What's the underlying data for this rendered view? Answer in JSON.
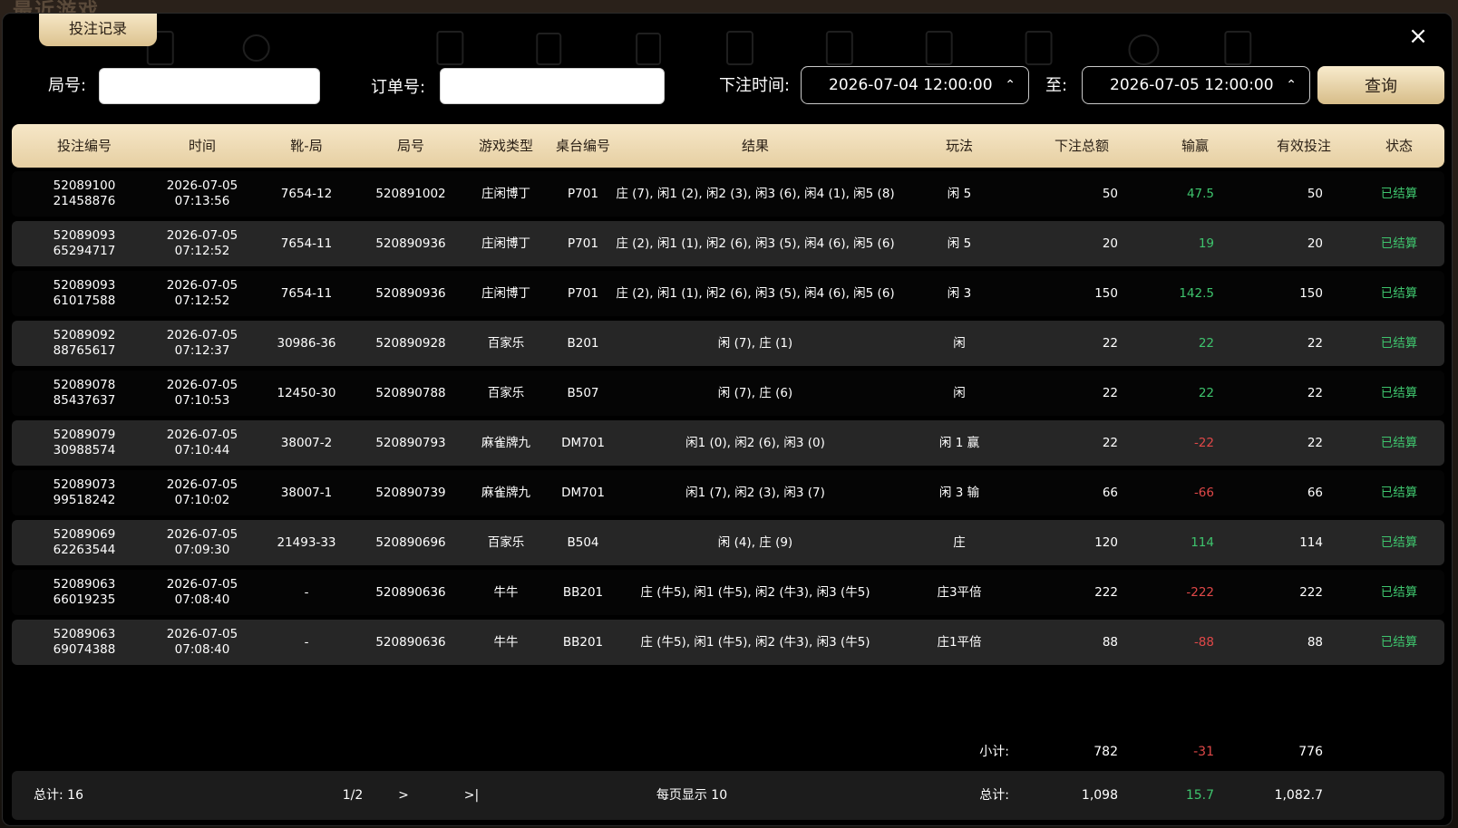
{
  "backdrop": {
    "title": "最近游戏"
  },
  "modal": {
    "tab_label": "投注记录",
    "close_glyph": "×"
  },
  "filters": {
    "round_label": "局号:",
    "round_value": "",
    "order_label": "订单号:",
    "order_value": "",
    "time_label": "下注时间:",
    "start_time": "2026-07-04 12:00:00",
    "to_label": "至:",
    "end_time": "2026-07-05 12:00:00",
    "query_label": "查询"
  },
  "table": {
    "headers": [
      "投注编号",
      "时间",
      "靴-局",
      "局号",
      "游戏类型",
      "桌台编号",
      "结果",
      "玩法",
      "下注总额",
      "输赢",
      "有效投注",
      "状态"
    ],
    "rows": [
      {
        "id1": "52089100",
        "id2": "21458876",
        "date": "2026-07-05",
        "time": "07:13:56",
        "shoe": "7654-12",
        "round": "520891002",
        "game": "庄闲博丁",
        "table": "P701",
        "result": "庄 (7), 闲1 (2), 闲2 (3), 闲3 (6), 闲4 (1), 闲5 (8)",
        "play": "闲 5",
        "bet": "50",
        "win": "47.5",
        "valid": "50",
        "status": "已结算"
      },
      {
        "id1": "52089093",
        "id2": "65294717",
        "date": "2026-07-05",
        "time": "07:12:52",
        "shoe": "7654-11",
        "round": "520890936",
        "game": "庄闲博丁",
        "table": "P701",
        "result": "庄 (2), 闲1 (1), 闲2 (6), 闲3 (5), 闲4 (6), 闲5 (6)",
        "play": "闲 5",
        "bet": "20",
        "win": "19",
        "valid": "20",
        "status": "已结算"
      },
      {
        "id1": "52089093",
        "id2": "61017588",
        "date": "2026-07-05",
        "time": "07:12:52",
        "shoe": "7654-11",
        "round": "520890936",
        "game": "庄闲博丁",
        "table": "P701",
        "result": "庄 (2), 闲1 (1), 闲2 (6), 闲3 (5), 闲4 (6), 闲5 (6)",
        "play": "闲 3",
        "bet": "150",
        "win": "142.5",
        "valid": "150",
        "status": "已结算"
      },
      {
        "id1": "52089092",
        "id2": "88765617",
        "date": "2026-07-05",
        "time": "07:12:37",
        "shoe": "30986-36",
        "round": "520890928",
        "game": "百家乐",
        "table": "B201",
        "result": "闲 (7), 庄 (1)",
        "play": "闲",
        "bet": "22",
        "win": "22",
        "valid": "22",
        "status": "已结算"
      },
      {
        "id1": "52089078",
        "id2": "85437637",
        "date": "2026-07-05",
        "time": "07:10:53",
        "shoe": "12450-30",
        "round": "520890788",
        "game": "百家乐",
        "table": "B507",
        "result": "闲 (7), 庄 (6)",
        "play": "闲",
        "bet": "22",
        "win": "22",
        "valid": "22",
        "status": "已结算"
      },
      {
        "id1": "52089079",
        "id2": "30988574",
        "date": "2026-07-05",
        "time": "07:10:44",
        "shoe": "38007-2",
        "round": "520890793",
        "game": "麻雀牌九",
        "table": "DM701",
        "result": "闲1 (0), 闲2 (6), 闲3 (0)",
        "play": "闲 1 赢",
        "bet": "22",
        "win": "-22",
        "valid": "22",
        "status": "已结算"
      },
      {
        "id1": "52089073",
        "id2": "99518242",
        "date": "2026-07-05",
        "time": "07:10:02",
        "shoe": "38007-1",
        "round": "520890739",
        "game": "麻雀牌九",
        "table": "DM701",
        "result": "闲1 (7), 闲2 (3), 闲3 (7)",
        "play": "闲 3 输",
        "bet": "66",
        "win": "-66",
        "valid": "66",
        "status": "已结算"
      },
      {
        "id1": "52089069",
        "id2": "62263544",
        "date": "2026-07-05",
        "time": "07:09:30",
        "shoe": "21493-33",
        "round": "520890696",
        "game": "百家乐",
        "table": "B504",
        "result": "闲 (4), 庄 (9)",
        "play": "庄",
        "bet": "120",
        "win": "114",
        "valid": "114",
        "status": "已结算"
      },
      {
        "id1": "52089063",
        "id2": "66019235",
        "date": "2026-07-05",
        "time": "07:08:40",
        "shoe": "-",
        "round": "520890636",
        "game": "牛牛",
        "table": "BB201",
        "result": "庄 (牛5), 闲1 (牛5), 闲2 (牛3), 闲3 (牛5)",
        "play": "庄3平倍",
        "bet": "222",
        "win": "-222",
        "valid": "222",
        "status": "已结算"
      },
      {
        "id1": "52089063",
        "id2": "69074388",
        "date": "2026-07-05",
        "time": "07:08:40",
        "shoe": "-",
        "round": "520890636",
        "game": "牛牛",
        "table": "BB201",
        "result": "庄 (牛5), 闲1 (牛5), 闲2 (牛3), 闲3 (牛5)",
        "play": "庄1平倍",
        "bet": "88",
        "win": "-88",
        "valid": "88",
        "status": "已结算"
      }
    ]
  },
  "subtotal": {
    "label": "小计:",
    "bet": "782",
    "win": "-31",
    "valid": "776"
  },
  "footer": {
    "count_label": "总计: 16",
    "page": "1/2",
    "next": ">",
    "last": ">|",
    "per_page": "每页显示 10",
    "total_label": "总计:",
    "bet": "1,098",
    "win": "15.7",
    "valid": "1,082.7"
  },
  "colors": {
    "gold": "#e6cfa2",
    "win": "#3ec46d",
    "lose": "#e04848"
  }
}
